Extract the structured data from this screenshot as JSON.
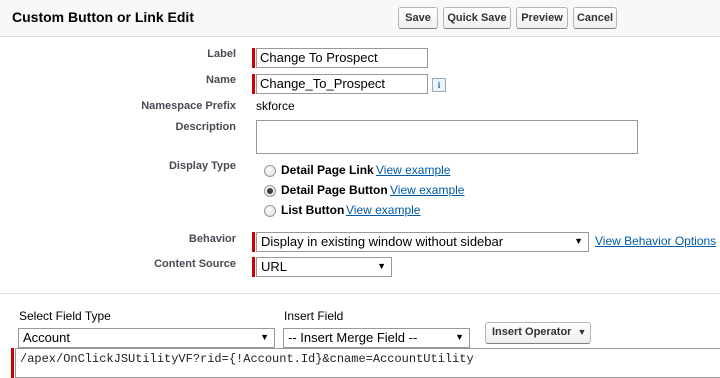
{
  "header": {
    "title": "Custom Button or Link Edit",
    "buttons": {
      "save": "Save",
      "quick_save": "Quick Save",
      "preview": "Preview",
      "cancel": "Cancel"
    }
  },
  "form": {
    "label": {
      "caption": "Label",
      "value": "Change To Prospect"
    },
    "name": {
      "caption": "Name",
      "value": "Change_To_Prospect",
      "info_icon": "i"
    },
    "namespace": {
      "caption": "Namespace Prefix",
      "value": "skforce"
    },
    "description": {
      "caption": "Description",
      "value": ""
    },
    "display_type": {
      "caption": "Display Type",
      "options": [
        {
          "label": "Detail Page Link",
          "link": "View example",
          "checked": false
        },
        {
          "label": "Detail Page Button",
          "link": "View example",
          "checked": true
        },
        {
          "label": "List Button",
          "link": "View example",
          "checked": false
        }
      ]
    },
    "behavior": {
      "caption": "Behavior",
      "value": "Display in existing window without sidebar",
      "link": "View Behavior Options"
    },
    "content_source": {
      "caption": "Content Source",
      "value": "URL"
    }
  },
  "formula_builder": {
    "select_field_type": {
      "caption": "Select Field Type",
      "value": "Account"
    },
    "insert_field": {
      "caption": "Insert Field",
      "value": "-- Insert Merge Field --"
    },
    "insert_operator": {
      "label": "Insert Operator"
    },
    "formula_text": "/apex/OnClickJSUtilityVF?rid={!Account.Id}&cname=AccountUtility"
  },
  "colors": {
    "required": "#cc0000",
    "link": "#015ba7",
    "label": "#4a4a56"
  }
}
